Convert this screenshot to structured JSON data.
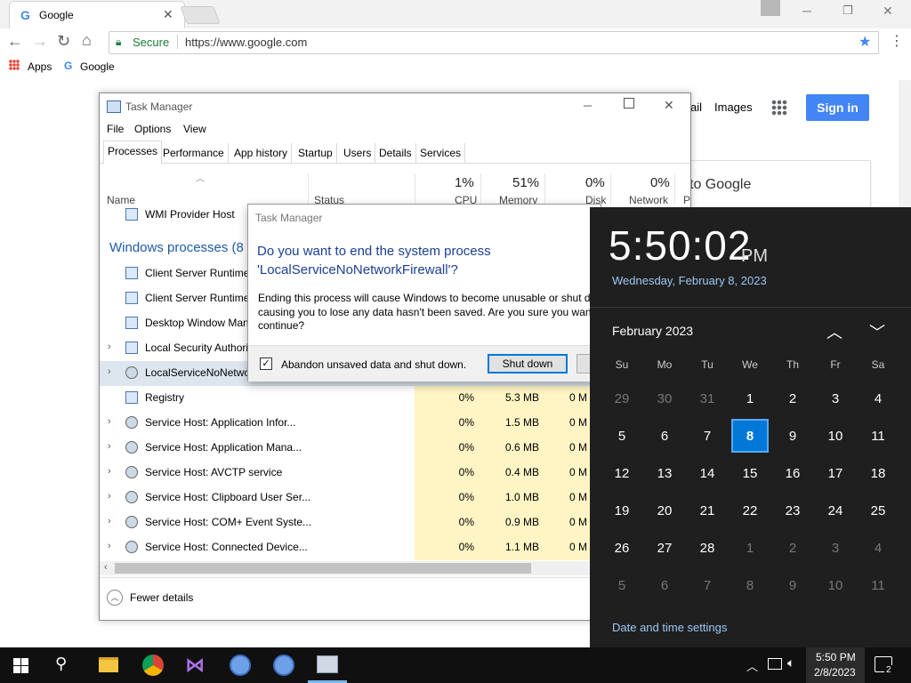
{
  "browser": {
    "tab_title": "Google",
    "secure_label": "Secure",
    "url": "https://www.google.com",
    "bookmarks": [
      {
        "label": "Apps"
      },
      {
        "label": "Google"
      }
    ]
  },
  "google": {
    "links": [
      {
        "label": "ail"
      },
      {
        "label": "Images"
      }
    ],
    "signin": "Sign in",
    "card_text": "to Google"
  },
  "taskmanager": {
    "title": "Task Manager",
    "menu": [
      "File",
      "Options",
      "View"
    ],
    "tabs": [
      "Processes",
      "Performance",
      "App history",
      "Startup",
      "Users",
      "Details",
      "Services"
    ],
    "columns": {
      "name": "Name",
      "status": "Status",
      "cpu_pct": "1%",
      "cpu": "CPU",
      "mem_pct": "51%",
      "mem": "Memory",
      "disk_pct": "0%",
      "disk": "Disk",
      "net_pct": "0%",
      "net": "Network",
      "power": "P"
    },
    "top_row": "WMI Provider Host",
    "group_label": "Windows processes (8",
    "partial_rows": [
      {
        "name": "Client Server Runtime"
      },
      {
        "name": "Client Server Runtime"
      },
      {
        "name": "Desktop Window Man"
      },
      {
        "name": "Local Security Authori"
      },
      {
        "name": "LocalServiceNoNetwo"
      }
    ],
    "rows": [
      {
        "name": "Registry",
        "cpu": "0%",
        "mem": "5.3 MB",
        "disk": "0 M"
      },
      {
        "name": "Service Host: Application Infor...",
        "cpu": "0%",
        "mem": "1.5 MB",
        "disk": "0 M"
      },
      {
        "name": "Service Host: Application Mana...",
        "cpu": "0%",
        "mem": "0.6 MB",
        "disk": "0 M"
      },
      {
        "name": "Service Host: AVCTP service",
        "cpu": "0%",
        "mem": "0.4 MB",
        "disk": "0 M"
      },
      {
        "name": "Service Host: Clipboard User Ser...",
        "cpu": "0%",
        "mem": "1.0 MB",
        "disk": "0 M"
      },
      {
        "name": "Service Host: COM+ Event Syste...",
        "cpu": "0%",
        "mem": "0.9 MB",
        "disk": "0 M"
      },
      {
        "name": "Service Host: Connected Device...",
        "cpu": "0%",
        "mem": "1.1 MB",
        "disk": "0 M"
      }
    ],
    "fewer_details": "Fewer details"
  },
  "dialog": {
    "title": "Task Manager",
    "question_line1": "Do you want to end the system process",
    "question_line2": "'LocalServiceNoNetworkFirewall'?",
    "body_line1": "Ending this process will cause Windows to become unusable or shut do",
    "body_line2": "causing you to lose any data hasn't been saved. Are you sure you want",
    "body_line3": "continue?",
    "checkbox_label": "Abandon unsaved data and shut down.",
    "shutdown_button": "Shut down"
  },
  "clock": {
    "time": "5:50:02",
    "ampm": "PM",
    "date_long": "Wednesday, February 8, 2023",
    "month_label": "February 2023",
    "weekdays": [
      "Su",
      "Mo",
      "Tu",
      "We",
      "Th",
      "Fr",
      "Sa"
    ],
    "weeks": [
      [
        "29",
        "30",
        "31",
        "1",
        "2",
        "3",
        "4"
      ],
      [
        "5",
        "6",
        "7",
        "8",
        "9",
        "10",
        "11"
      ],
      [
        "12",
        "13",
        "14",
        "15",
        "16",
        "17",
        "18"
      ],
      [
        "19",
        "20",
        "21",
        "22",
        "23",
        "24",
        "25"
      ],
      [
        "26",
        "27",
        "28",
        "1",
        "2",
        "3",
        "4"
      ],
      [
        "5",
        "6",
        "7",
        "8",
        "9",
        "10",
        "11"
      ]
    ],
    "settings_link": "Date and time settings"
  },
  "taskbar": {
    "time": "5:50 PM",
    "date": "2/8/2023",
    "notif_count": "2"
  },
  "colors": {
    "accent": "#0078d7",
    "google_blue": "#4285f4",
    "cpu_highlight": "#fff4c4"
  }
}
